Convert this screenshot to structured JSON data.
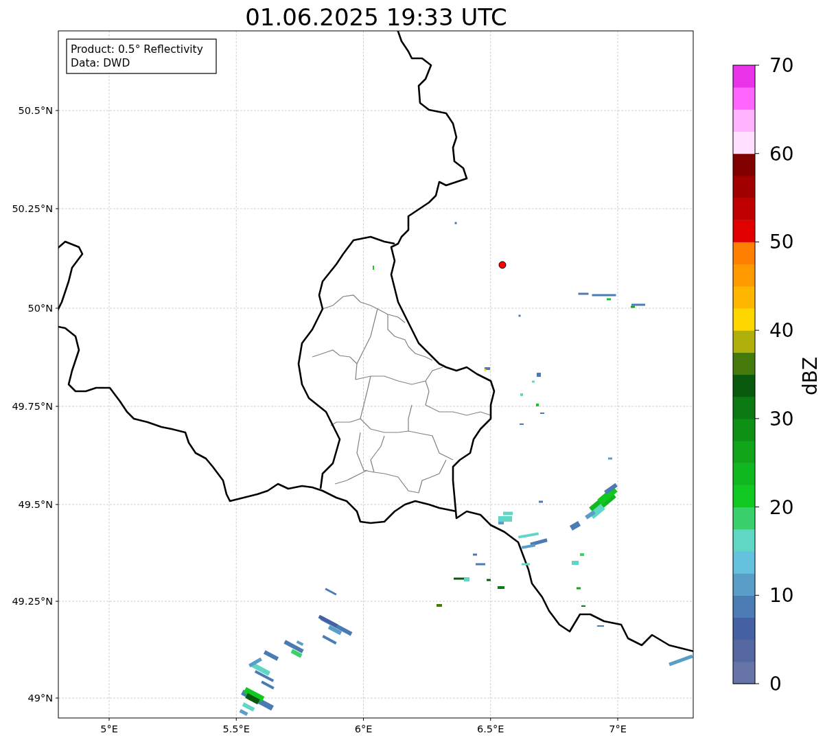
{
  "title": "01.06.2025 19:33 UTC",
  "info_box": [
    "Product: 0.5° Reflectivity",
    "Data: DWD"
  ],
  "map": {
    "lat_ticks": [
      "50.5°N",
      "50.25°N",
      "50°N",
      "49.75°N",
      "49.5°N",
      "49.25°N",
      "49°N"
    ],
    "lon_ticks": [
      "5°E",
      "5.5°E",
      "6°E",
      "6.5°E",
      "7°E"
    ]
  },
  "colorbar": {
    "label": "dBZ",
    "ticks": [
      "70",
      "60",
      "50",
      "40",
      "30",
      "20",
      "10",
      "0"
    ],
    "bands": [
      {
        "color": "#6674a8"
      },
      {
        "color": "#5567a0"
      },
      {
        "color": "#4560a3"
      },
      {
        "color": "#4a7bb3"
      },
      {
        "color": "#599ec9"
      },
      {
        "color": "#65c2de"
      },
      {
        "color": "#60d7c4"
      },
      {
        "color": "#3ad06c"
      },
      {
        "color": "#10c820"
      },
      {
        "color": "#10b820"
      },
      {
        "color": "#10a418"
      },
      {
        "color": "#0e9015"
      },
      {
        "color": "#0b7a13"
      },
      {
        "color": "#0a5a0e"
      },
      {
        "color": "#457a0a"
      },
      {
        "color": "#b0b00a"
      },
      {
        "color": "#ffd700"
      },
      {
        "color": "#ffb600"
      },
      {
        "color": "#ff9900"
      },
      {
        "color": "#ff8000"
      },
      {
        "color": "#e00000"
      },
      {
        "color": "#c00000"
      },
      {
        "color": "#a00000"
      },
      {
        "color": "#800000"
      },
      {
        "color": "#ffe0ff"
      },
      {
        "color": "#ffb3ff"
      },
      {
        "color": "#ff66ff"
      },
      {
        "color": "#e833e8"
      }
    ]
  }
}
